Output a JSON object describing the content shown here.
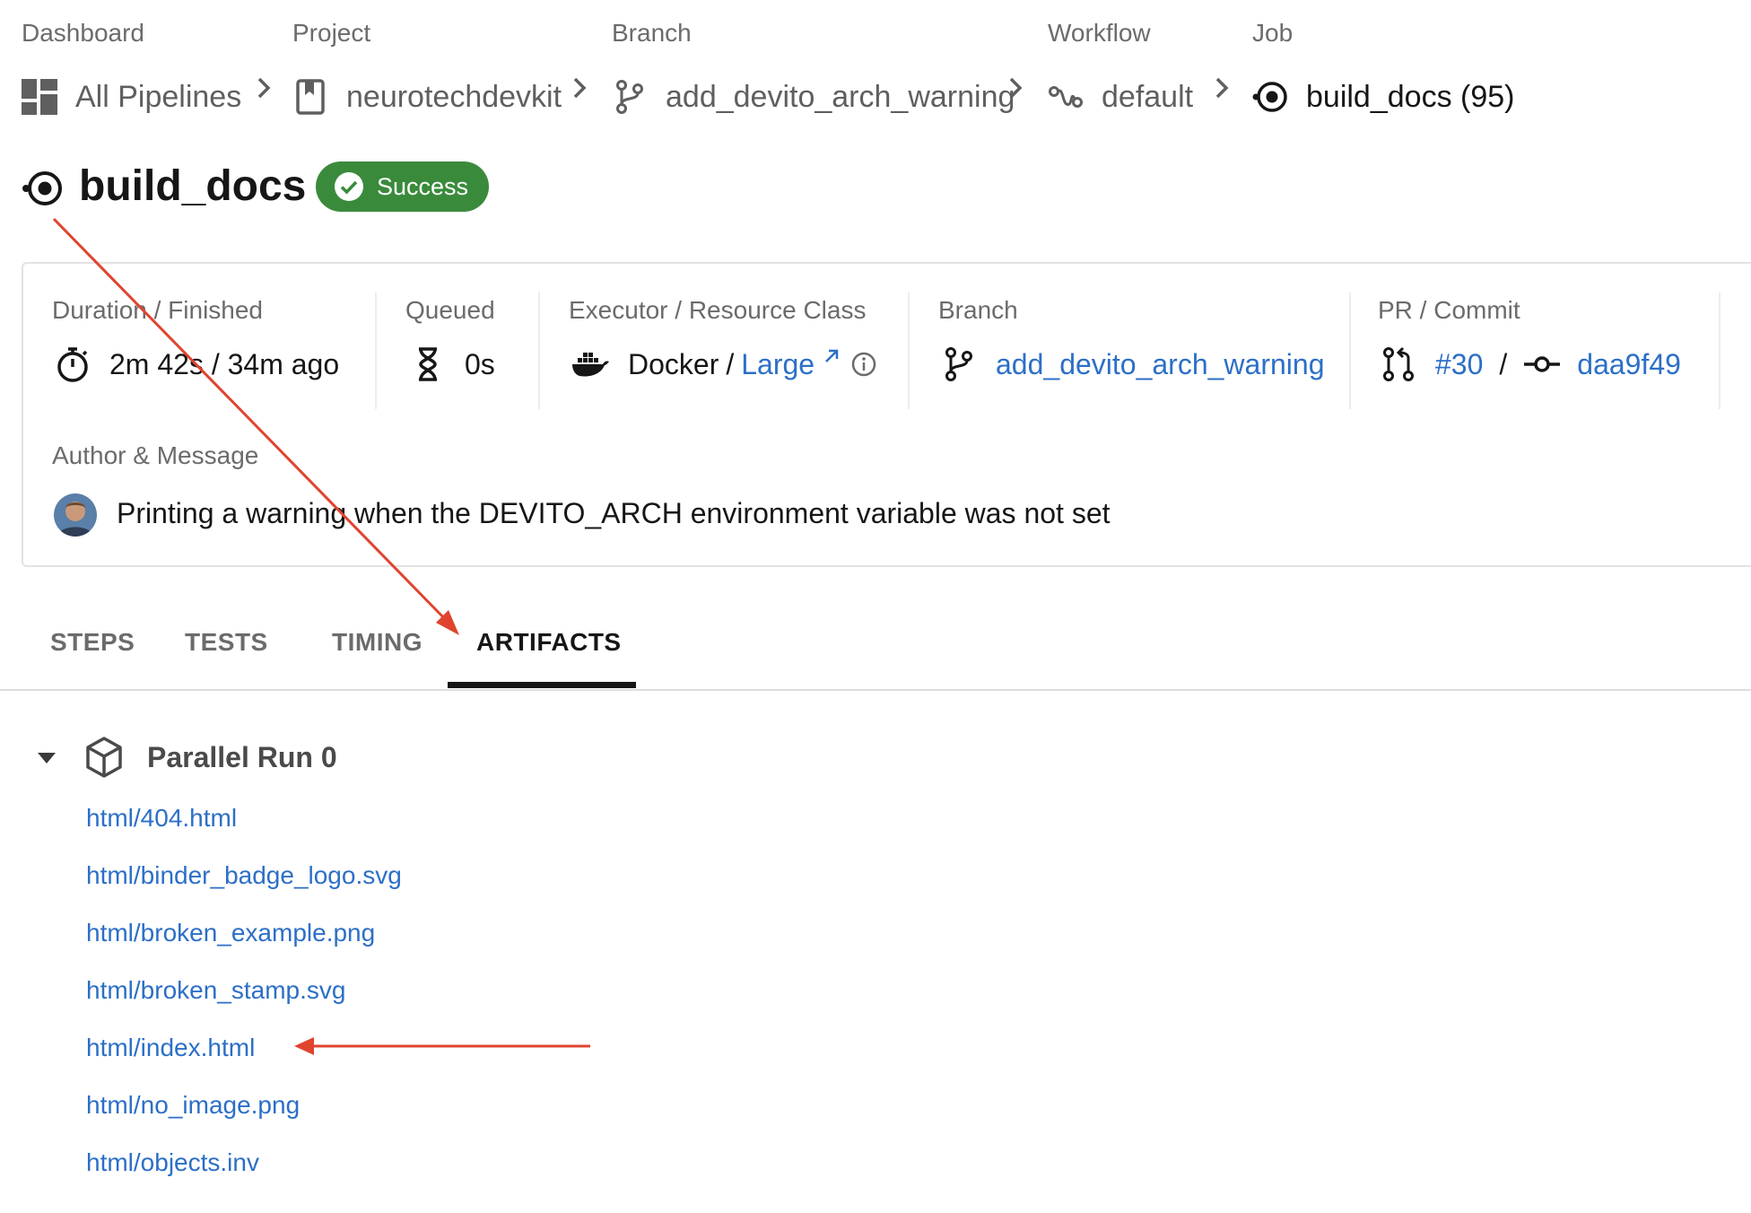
{
  "breadcrumb": [
    {
      "label": "Dashboard",
      "value": "All Pipelines",
      "icon": "dashboard-grid-icon"
    },
    {
      "label": "Project",
      "value": "neurotechdevkit",
      "icon": "bookmark-icon"
    },
    {
      "label": "Branch",
      "value": "add_devito_arch_warning",
      "icon": "branch-icon"
    },
    {
      "label": "Workflow",
      "value": "default",
      "icon": "workflow-icon"
    },
    {
      "label": "Job",
      "value": "build_docs (95)",
      "icon": "job-icon"
    }
  ],
  "job": {
    "title": "build_docs",
    "status": "Success",
    "status_color": "#3a8a3c"
  },
  "info": {
    "duration_label": "Duration / Finished",
    "duration_value": "2m 42s / 34m ago",
    "queued_label": "Queued",
    "queued_value": "0s",
    "executor_label": "Executor / Resource Class",
    "executor_value": "Docker",
    "separator": "/",
    "resource_class": "Large",
    "branch_label": "Branch",
    "branch_value": "add_devito_arch_warning",
    "pr_label": "PR / Commit",
    "pr_value": "#30",
    "commit_value": "daa9f49",
    "author_label": "Author & Message",
    "message": "Printing a warning when the DEVITO_ARCH environment variable was not set"
  },
  "tabs": [
    "STEPS",
    "TESTS",
    "TIMING",
    "ARTIFACTS"
  ],
  "active_tab": "ARTIFACTS",
  "artifacts": {
    "group_title": "Parallel Run 0",
    "items": [
      "html/404.html",
      "html/binder_badge_logo.svg",
      "html/broken_example.png",
      "html/broken_stamp.svg",
      "html/index.html",
      "html/no_image.png",
      "html/objects.inv"
    ]
  },
  "colors": {
    "link": "#2c6fc7",
    "annotation_arrow": "#e0442f",
    "success": "#3a8a3c"
  }
}
